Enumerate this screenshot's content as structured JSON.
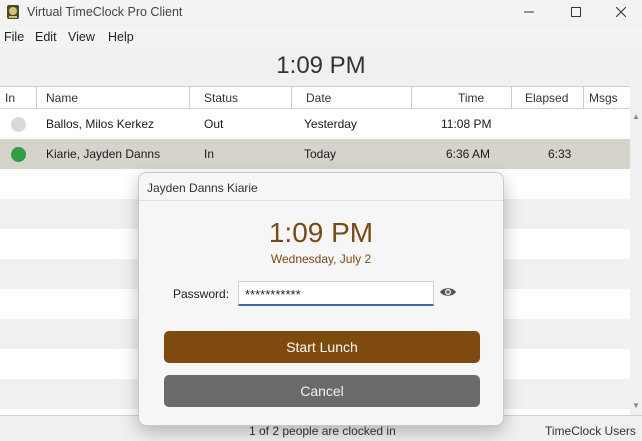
{
  "window": {
    "title": "Virtual TimeClock Pro Client"
  },
  "menu": [
    "File",
    "Edit",
    "View",
    "Help"
  ],
  "clock": {
    "time": "1:09 PM"
  },
  "table": {
    "columns": [
      "In",
      "Name",
      "Status",
      "Date",
      "Time",
      "Elapsed",
      "Msgs"
    ],
    "rows": [
      {
        "in_color": "#d9d9d9",
        "name": "Ballos, Milos Kerkez",
        "status": "Out",
        "date": "Yesterday",
        "time": "11:08 PM",
        "elapsed": "",
        "msgs": ""
      },
      {
        "in_color": "#2f9e44",
        "name": "Kiarie, Jayden Danns",
        "status": "In",
        "date": "Today",
        "time": "6:36 AM",
        "elapsed": "6:33",
        "msgs": ""
      }
    ]
  },
  "status": {
    "summary": "1 of 2 people are clocked in",
    "right": "TimeClock Users"
  },
  "dialog": {
    "title": "Jayden Danns Kiarie",
    "time": "1:09 PM",
    "date": "Wednesday, July 2",
    "password_label": "Password:",
    "password_value": "***********",
    "primary_button": "Start Lunch",
    "secondary_button": "Cancel"
  },
  "colors": {
    "accent": "#7e4a0e",
    "clocked_in": "#2f9e44",
    "clocked_out": "#d9d9d9"
  },
  "icons": {
    "app": "timeclock-app-icon",
    "reveal": "eye-icon"
  }
}
